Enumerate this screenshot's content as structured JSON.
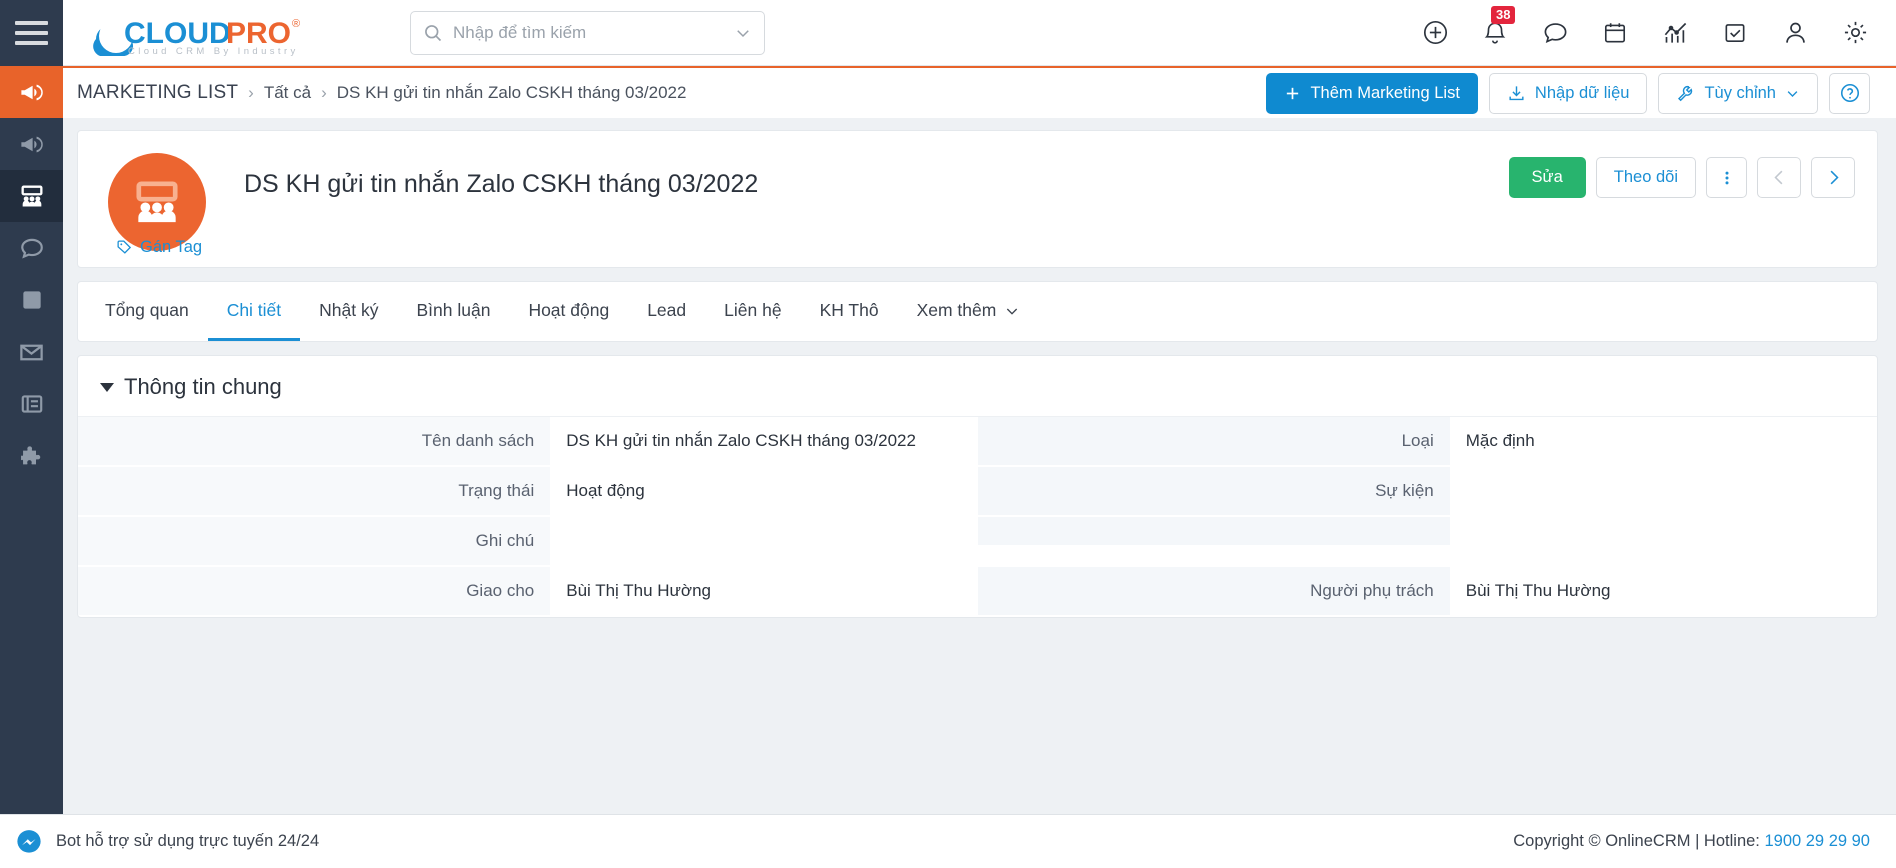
{
  "topbar": {
    "menu_icon": "hamburger-icon",
    "logo": {
      "text_cloud": "CLOUD",
      "text_pro": "PRO",
      "registered": "®",
      "tagline": "Cloud CRM By Industry"
    },
    "search": {
      "placeholder": "Nhập để tìm kiếm",
      "value": "",
      "search_icon": "search-icon",
      "dropdown_icon": "chevron-down-icon"
    },
    "icons": [
      {
        "name": "add-circle-icon",
        "label": "Thêm"
      },
      {
        "name": "bell-icon",
        "label": "Thông báo",
        "badge": "38"
      },
      {
        "name": "chat-bubble-icon",
        "label": "Trò chuyện"
      },
      {
        "name": "calendar-icon",
        "label": "Lịch"
      },
      {
        "name": "chart-icon",
        "label": "Báo cáo"
      },
      {
        "name": "check-square-icon",
        "label": "Công việc"
      },
      {
        "name": "user-icon",
        "label": "Tài khoản"
      },
      {
        "name": "gear-icon",
        "label": "Cài đặt"
      }
    ]
  },
  "rail": {
    "items": [
      {
        "name": "rail-item-megaphone-orange",
        "icon": "megaphone-icon",
        "state": "active"
      },
      {
        "name": "rail-item-megaphone",
        "icon": "megaphone-icon",
        "state": "normal"
      },
      {
        "name": "rail-item-marketing-list",
        "icon": "people-group-icon",
        "state": "current"
      },
      {
        "name": "rail-item-chat",
        "icon": "chat-bubble-icon",
        "state": "normal"
      },
      {
        "name": "rail-item-page",
        "icon": "page-icon",
        "state": "normal"
      },
      {
        "name": "rail-item-email",
        "icon": "envelope-icon",
        "state": "normal"
      },
      {
        "name": "rail-item-form",
        "icon": "form-icon",
        "state": "normal"
      },
      {
        "name": "rail-item-extension",
        "icon": "puzzle-icon",
        "state": "normal"
      }
    ]
  },
  "breadcrumb": {
    "module": "MARKETING LIST",
    "sep": "›",
    "parent": "Tất cả",
    "current": "DS KH gửi tin nhắn Zalo CSKH tháng 03/2022"
  },
  "page_actions": {
    "add_label": "Thêm Marketing List",
    "add_icon": "plus-icon",
    "import_label": "Nhập dữ liệu",
    "import_icon": "download-icon",
    "customize_label": "Tùy chỉnh",
    "customize_icon": "wrench-icon",
    "customize_caret": "chevron-down-icon",
    "help_icon": "question-circle-icon"
  },
  "record": {
    "avatar_icon": "people-group-icon",
    "avatar_color": "#ec6530",
    "title": "DS KH gửi tin nhắn Zalo CSKH tháng 03/2022",
    "tag_label": "Gán Tag",
    "tag_icon": "tag-icon",
    "actions": {
      "edit_label": "Sửa",
      "edit_color": "#28b46e",
      "follow_label": "Theo dõi",
      "more_icon": "more-vertical-icon",
      "prev_icon": "chevron-left-icon",
      "next_icon": "chevron-right-icon"
    }
  },
  "tabs": {
    "active_index": 1,
    "items": [
      {
        "label": "Tổng quan"
      },
      {
        "label": "Chi tiết"
      },
      {
        "label": "Nhật ký"
      },
      {
        "label": "Bình luận"
      },
      {
        "label": "Hoạt động"
      },
      {
        "label": "Lead"
      },
      {
        "label": "Liên hệ"
      },
      {
        "label": "KH Thô"
      }
    ],
    "more_label": "Xem thêm",
    "more_icon": "chevron-down-icon"
  },
  "detail": {
    "section_title": "Thông tin chung",
    "left_fields": [
      {
        "label": "Tên danh sách",
        "value": "DS KH gửi tin nhắn Zalo CSKH tháng 03/2022"
      },
      {
        "label": "Trạng thái",
        "value": "Hoạt động"
      },
      {
        "label": "Ghi chú",
        "value": ""
      },
      {
        "label": "Giao cho",
        "value": "Bùi Thị Thu Hường"
      }
    ],
    "right_fields": [
      {
        "label": "Loại",
        "value": "Mặc định"
      },
      {
        "label": "Sự kiện",
        "value": ""
      },
      {
        "label": "",
        "value": ""
      },
      {
        "label": "Người phụ trách",
        "value": "Bùi Thị Thu Hường"
      }
    ]
  },
  "footer": {
    "bot_icon": "messenger-icon",
    "bot_text": "Bot hỗ trợ sử dụng trực tuyến 24/24",
    "copyright": "Copyright © OnlineCRM | Hotline: ",
    "hotline": "1900 29 29 90"
  }
}
